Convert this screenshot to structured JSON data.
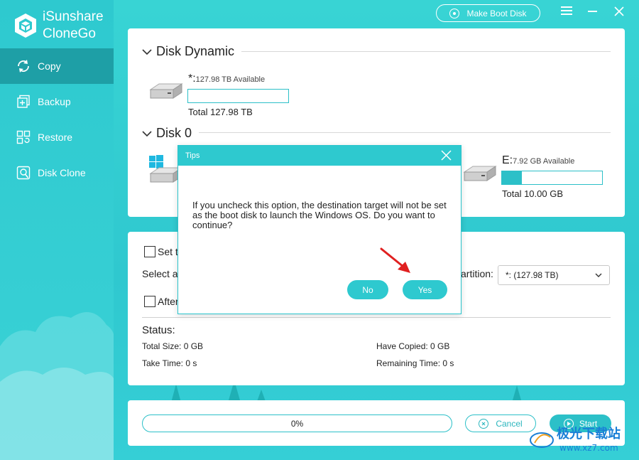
{
  "app": {
    "name_line1": "iSunshare",
    "name_line2": "CloneGo",
    "accent_color": "#2ec9cf",
    "active_color": "#1e9fa6"
  },
  "sidebar": {
    "items": [
      {
        "label": "Copy",
        "icon": "refresh-icon",
        "active": true
      },
      {
        "label": "Backup",
        "icon": "backup-icon",
        "active": false
      },
      {
        "label": "Restore",
        "icon": "restore-icon",
        "active": false
      },
      {
        "label": "Disk Clone",
        "icon": "disk-clone-icon",
        "active": false
      }
    ]
  },
  "topbar": {
    "boot_button_label": "Make Boot Disk"
  },
  "disk_groups": {
    "dynamic": {
      "title": "Disk Dynamic",
      "partition_letter": "*:",
      "available": "127.98 TB Available",
      "total": "Total 127.98 TB",
      "used_fraction": 0
    },
    "disk0": {
      "title": "Disk 0",
      "partition_letter": "E:",
      "available": "7.92 GB Available",
      "total": "Total 10.00 GB",
      "used_fraction": 0.2
    }
  },
  "options": {
    "set_label": "Set t",
    "select_label": "Select a",
    "after_label": "After",
    "partition_label": "artition:",
    "partition_value": "*:    (127.98 TB)"
  },
  "status": {
    "title": "Status:",
    "total_size": "Total Size: 0 GB",
    "have_copied": "Have Copied: 0 GB",
    "take_time": "Take Time: 0 s",
    "remaining_time": "Remaining Time: 0 s"
  },
  "footer": {
    "progress_text": "0%",
    "progress_value": 0,
    "cancel_label": "Cancel",
    "start_label": "Start"
  },
  "dialog": {
    "title": "Tips",
    "message": "If you uncheck this option, the destination target will not be set as the boot disk to launch the Windows OS. Do you want to continue?",
    "no_label": "No",
    "yes_label": "Yes"
  },
  "watermark": {
    "text": "极光下载站",
    "url": "www.xz7.com"
  }
}
